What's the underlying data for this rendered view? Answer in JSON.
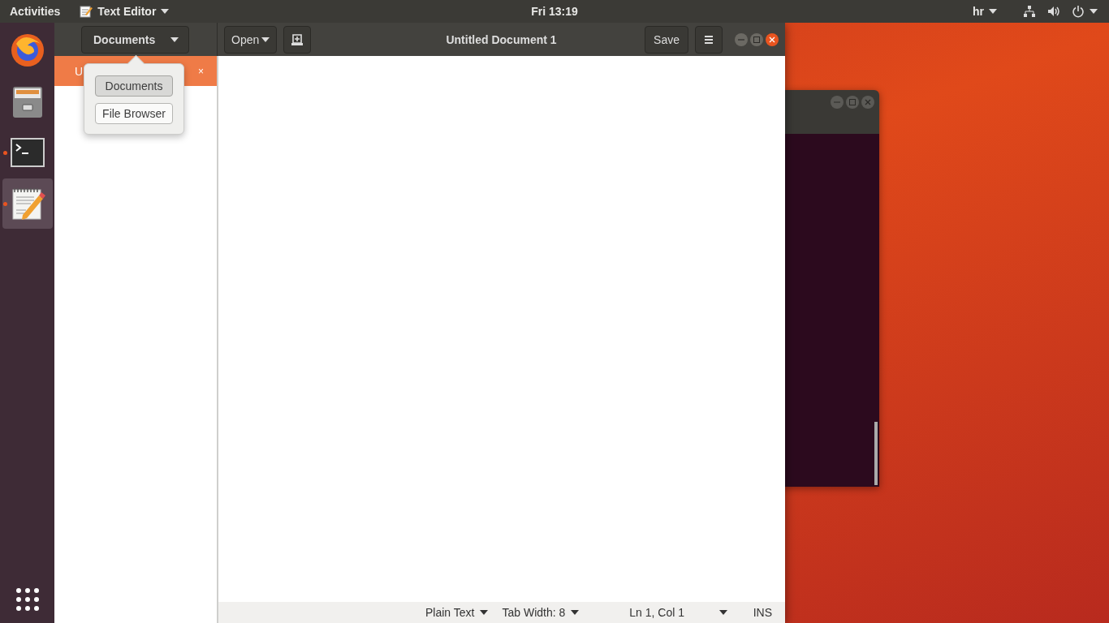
{
  "top_bar": {
    "activities": "Activities",
    "app_menu": "Text Editor",
    "clock": "Fri 13:19",
    "keyboard_layout": "hr"
  },
  "dock": {
    "items": [
      {
        "kind": "browser",
        "running": false,
        "selected": false
      },
      {
        "kind": "files",
        "running": false,
        "selected": false
      },
      {
        "kind": "terminal",
        "running": true,
        "selected": false
      },
      {
        "kind": "editor",
        "running": true,
        "selected": true
      }
    ]
  },
  "editor_window": {
    "side_panel_button": "Documents",
    "open_button": "Open",
    "title": "Untitled Document 1",
    "save_button": "Save",
    "document_tabs": [
      {
        "label": "U",
        "close": "×",
        "selected": true
      }
    ],
    "popover": {
      "items": [
        {
          "label": "Documents",
          "selected": true
        },
        {
          "label": "File Browser",
          "selected": false
        }
      ]
    },
    "status_bar": {
      "language": "Plain Text",
      "tab_width": "Tab Width: 8",
      "position": "Ln 1, Col 1",
      "mode": "INS"
    }
  }
}
